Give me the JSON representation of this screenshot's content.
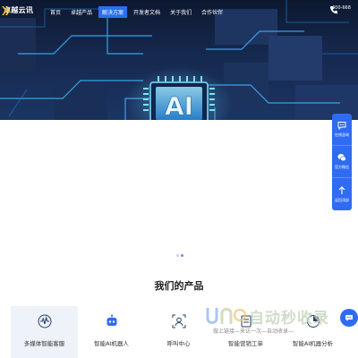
{
  "brand": {
    "name": "卓越云讯",
    "accent": "#2a6ff2"
  },
  "nav": {
    "items": [
      {
        "label": "首页",
        "active": false
      },
      {
        "label": "卓越产品",
        "active": false
      },
      {
        "label": "解决方案",
        "active": true
      },
      {
        "label": "开发者文档",
        "active": false
      },
      {
        "label": "关于我们",
        "active": false
      },
      {
        "label": "合作伙伴",
        "active": false
      }
    ],
    "phone": "400-668"
  },
  "hero": {
    "chip_text": "AI"
  },
  "float_bar": [
    {
      "label": "在线咨询",
      "icon": "chat-icon"
    },
    {
      "label": "官方微信",
      "icon": "wechat-icon"
    },
    {
      "label": "返回顶部",
      "icon": "arrow-up-icon"
    }
  ],
  "carousel": {
    "dots": 2,
    "active": 1
  },
  "products": {
    "title": "我们的产品",
    "items": [
      {
        "label": "多媒体智能客服",
        "icon": "waveform-icon",
        "active": true
      },
      {
        "label": "智能AI机器人",
        "icon": "robot-icon",
        "active": false
      },
      {
        "label": "呼叫中心",
        "icon": "headset-icon",
        "active": false
      },
      {
        "label": "智能营销工单",
        "icon": "list-icon",
        "active": false
      },
      {
        "label": "智能AI机器分析",
        "icon": "analysis-icon",
        "active": false
      }
    ]
  },
  "watermark": {
    "text": "自动秒收录",
    "sub": "做上链接—来访一次—自动收录—"
  }
}
